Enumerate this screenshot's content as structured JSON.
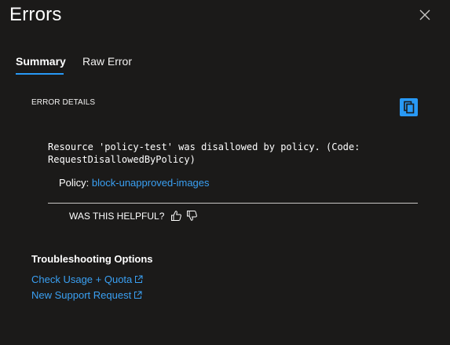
{
  "panel": {
    "title": "Errors",
    "close_icon": "close-icon"
  },
  "tabs": [
    {
      "label": "Summary",
      "active": true
    },
    {
      "label": "Raw Error",
      "active": false
    }
  ],
  "error_details": {
    "section_label": "ERROR DETAILS",
    "copy_icon": "copy-icon",
    "message": "Resource 'policy-test' was disallowed by policy. (Code:\nRequestDisallowedByPolicy)",
    "policy_label": "Policy:",
    "policy_link": "block-unapproved-images",
    "helpful_prompt": "WAS THIS HELPFUL?",
    "thumbs_up_icon": "thumbs-up-icon",
    "thumbs_down_icon": "thumbs-down-icon"
  },
  "troubleshooting": {
    "title": "Troubleshooting Options",
    "links": [
      {
        "label": "Check Usage + Quota",
        "icon": "external-link-icon"
      },
      {
        "label": "New Support Request",
        "icon": "external-link-icon"
      }
    ]
  },
  "colors": {
    "background": "#1b1a19",
    "accent": "#2899f5",
    "link": "#3aa0f3",
    "text": "#ffffff",
    "divider": "#c8c6c4"
  }
}
